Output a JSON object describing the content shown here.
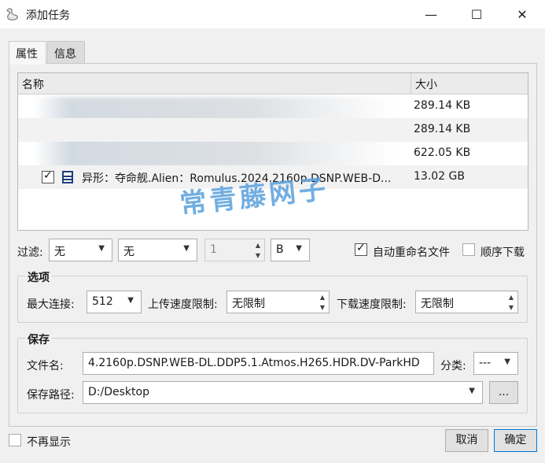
{
  "window": {
    "title": "添加任务",
    "controls": {
      "minimize": "—",
      "maximize": "☐",
      "close": "✕"
    }
  },
  "tabs": [
    {
      "label": "属性",
      "active": true
    },
    {
      "label": "信息",
      "active": false
    }
  ],
  "file_list": {
    "columns": {
      "name": "名称",
      "size": "大小"
    },
    "rows": [
      {
        "name": "",
        "size": "289.14 KB",
        "checked": false,
        "blurred": true
      },
      {
        "name": "",
        "size": "289.14 KB",
        "checked": false,
        "blurred": true
      },
      {
        "name": "",
        "size": "622.05 KB",
        "checked": false,
        "blurred": true
      },
      {
        "name": "异形：夺命舰.Alien：Romulus.2024.2160p.DSNP.WEB-D...",
        "size": "13.02 GB",
        "checked": true,
        "icon": "film-icon"
      }
    ]
  },
  "watermark": "常青藤网子",
  "filter": {
    "label": "过滤:",
    "combo1": "无",
    "combo2": "无",
    "amount": "1",
    "unit": "B",
    "auto_rename_label": "自动重命名文件",
    "auto_rename_checked": true,
    "sequential_label": "顺序下载",
    "sequential_checked": false
  },
  "options": {
    "title": "选项",
    "max_connections_label": "最大连接:",
    "max_connections": "512",
    "upload_limit_label": "上传速度限制:",
    "upload_limit": "无限制",
    "download_limit_label": "下载速度限制:",
    "download_limit": "无限制"
  },
  "save": {
    "title": "保存",
    "filename_label": "文件名:",
    "filename": "4.2160p.DSNP.WEB-DL.DDP5.1.Atmos.H265.HDR.DV-ParkHD",
    "category_label": "分类:",
    "category": "---",
    "path_label": "保存路径:",
    "path": "D:/Desktop",
    "browse": "..."
  },
  "footer": {
    "dont_show_label": "不再显示",
    "dont_show_checked": false,
    "cancel": "取消",
    "ok": "确定"
  },
  "colors": {
    "accent": "#0078d7",
    "watermark": "#5aa0dc",
    "icon": "#1e3c80"
  }
}
